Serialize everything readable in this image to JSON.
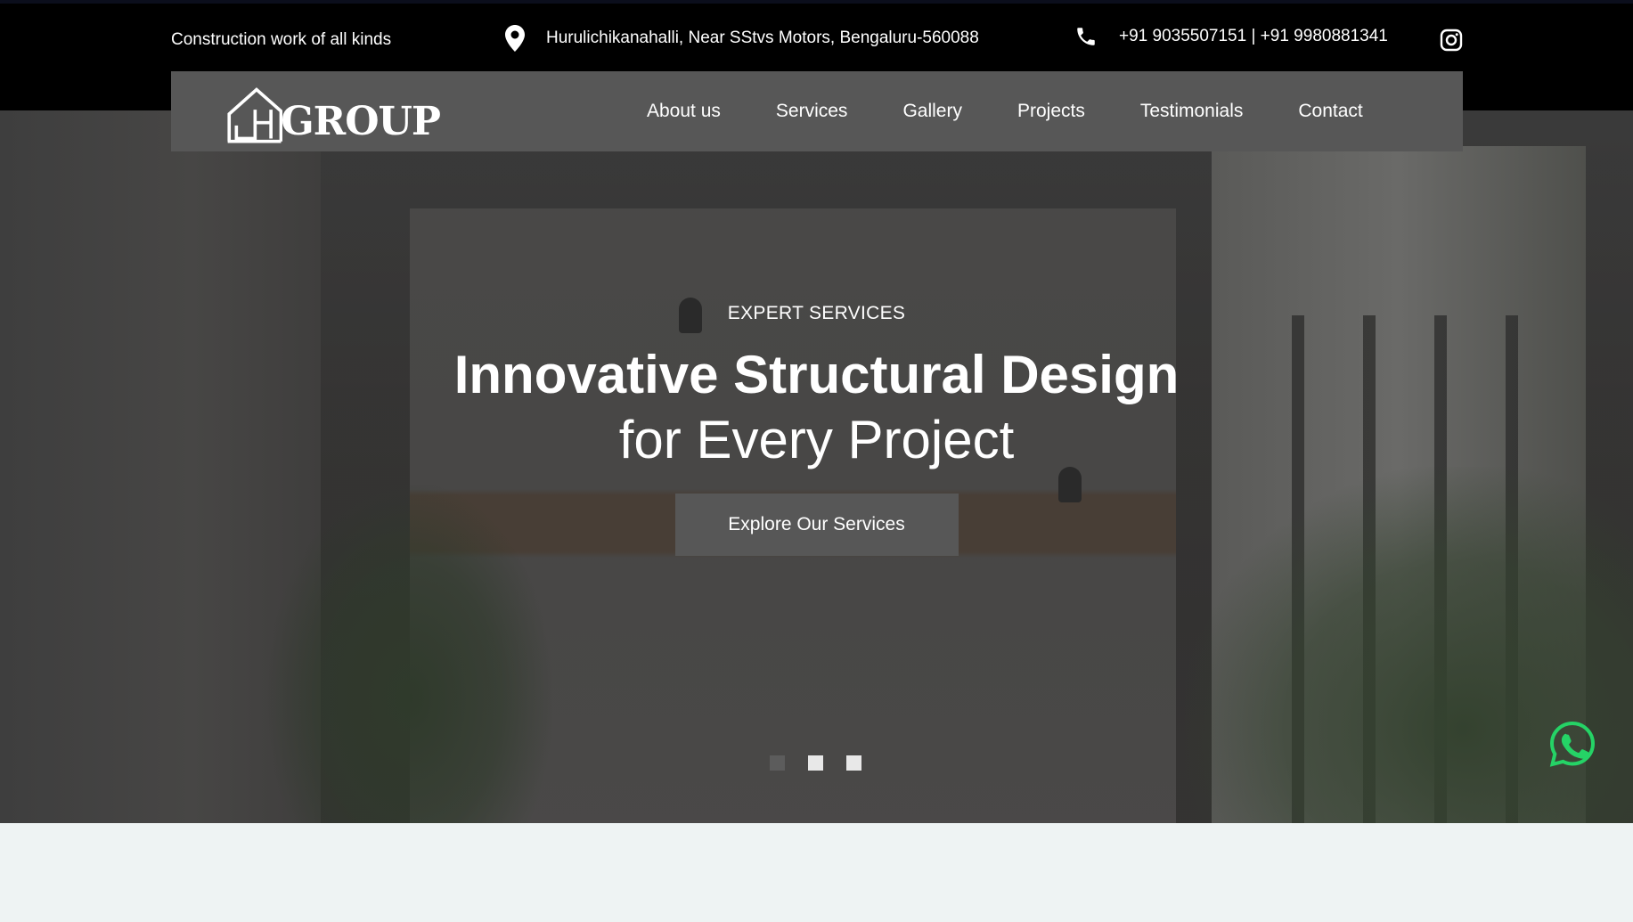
{
  "topbar": {
    "tagline": "Construction work of all kinds",
    "address": "Hurulichikanahalli, Near SStvs Motors, Bengaluru-560088",
    "phones": "+91 9035507151 | +91 9980881341",
    "icons": {
      "address": "map-pin-icon",
      "phone": "phone-icon",
      "social": "instagram-icon"
    }
  },
  "navbar": {
    "logo_text": "GROUP",
    "links": [
      "About us",
      "Services",
      "Gallery",
      "Projects",
      "Testimonials",
      "Contact"
    ]
  },
  "hero": {
    "eyebrow": "EXPERT SERVICES",
    "title": "Innovative Structural Design",
    "subtitle": "for Every Project",
    "cta_label": "Explore Our Services",
    "slider": {
      "total_slides": 3,
      "current_slide": 1
    }
  },
  "colors": {
    "topbar_bg": "#000000",
    "navbar_bg": "#575757",
    "button_bg": "#575757",
    "whatsapp": "#25d366",
    "page_bg": "#eef3f3"
  }
}
